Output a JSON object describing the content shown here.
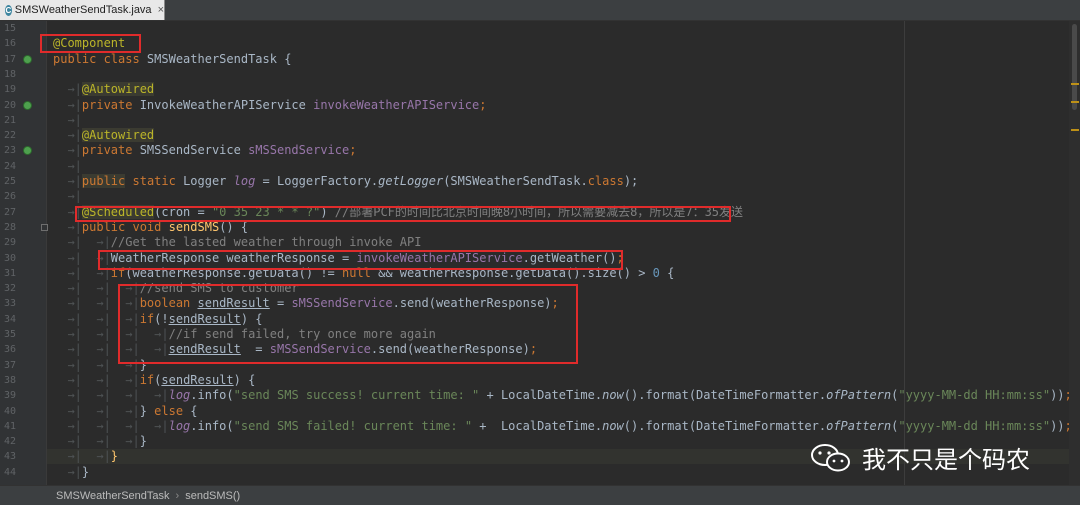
{
  "tab": {
    "label": "SMSWeatherSendTask.java",
    "icon": "java-class-icon"
  },
  "breadcrumb": {
    "class_name": "SMSWeatherSendTask",
    "method_name": "sendSMS()"
  },
  "watermark": {
    "text": "我不只是个码农",
    "icon": "wechat-icon"
  },
  "gutter": [
    {
      "n": "15"
    },
    {
      "n": "16"
    },
    {
      "n": "17",
      "icon": "spring-bean-icon"
    },
    {
      "n": "18"
    },
    {
      "n": "19"
    },
    {
      "n": "20",
      "icon": "spring-bean-icon"
    },
    {
      "n": "21"
    },
    {
      "n": "22"
    },
    {
      "n": "23",
      "icon": "spring-bean-icon"
    },
    {
      "n": "24"
    },
    {
      "n": "25"
    },
    {
      "n": "26"
    },
    {
      "n": "27"
    },
    {
      "n": "28",
      "fold": true
    },
    {
      "n": "29"
    },
    {
      "n": "30"
    },
    {
      "n": "31"
    },
    {
      "n": "32"
    },
    {
      "n": "33"
    },
    {
      "n": "34"
    },
    {
      "n": "35"
    },
    {
      "n": "36"
    },
    {
      "n": "37"
    },
    {
      "n": "38"
    },
    {
      "n": "39"
    },
    {
      "n": "40"
    },
    {
      "n": "41"
    },
    {
      "n": "42"
    },
    {
      "n": "43"
    },
    {
      "n": "44"
    }
  ],
  "code": [
    [],
    [
      [
        "ann",
        "@Component"
      ]
    ],
    [
      [
        "kw",
        "public class "
      ],
      [
        "",
        "SMSWeatherSendTask {"
      ]
    ],
    [],
    [
      [
        "ws",
        "    "
      ],
      [
        "ann annbg",
        "@Autowired"
      ]
    ],
    [
      [
        "ws",
        "    "
      ],
      [
        "kw",
        "private "
      ],
      [
        "",
        "InvokeWeatherAPIService "
      ],
      [
        "fld",
        "invokeWeatherAPIService"
      ],
      [
        "kw",
        ";"
      ]
    ],
    [
      [
        "ws",
        "    "
      ]
    ],
    [
      [
        "ws",
        "    "
      ],
      [
        "ann annbg",
        "@Autowired"
      ]
    ],
    [
      [
        "ws",
        "    "
      ],
      [
        "kw",
        "private "
      ],
      [
        "",
        "SMSSendService "
      ],
      [
        "fld",
        "sMSSendService"
      ],
      [
        "kw",
        ";"
      ]
    ],
    [
      [
        "ws",
        "    "
      ]
    ],
    [
      [
        "ws",
        "    "
      ],
      [
        "kw annbg",
        "public"
      ],
      [
        "kw",
        " static "
      ],
      [
        "",
        "Logger "
      ],
      [
        "fi",
        "log"
      ],
      [
        "",
        " = LoggerFactory."
      ],
      [
        "st",
        "getLogger"
      ],
      [
        "",
        "(SMSWeatherSendTask."
      ],
      [
        "kw",
        "class"
      ],
      [
        "",
        "); "
      ]
    ],
    [
      [
        "ws",
        "    "
      ]
    ],
    [
      [
        "ws",
        "    "
      ],
      [
        "ann annbg",
        "@Scheduled"
      ],
      [
        "",
        "(cron = "
      ],
      [
        "str",
        "\"0 35 23 * * ?\""
      ],
      [
        "",
        ") "
      ],
      [
        "cm",
        "//部署PCF的时间比北京时间晚8小时间，所以需要减去8，所以是7：35发送"
      ]
    ],
    [
      [
        "ws",
        "    "
      ],
      [
        "kw",
        "public void "
      ],
      [
        "fn",
        "sendSMS"
      ],
      [
        "",
        "() {"
      ]
    ],
    [
      [
        "ws",
        "        "
      ],
      [
        "cm",
        "//Get the lasted weather through invoke API"
      ]
    ],
    [
      [
        "ws",
        "        "
      ],
      [
        "",
        "WeatherResponse weatherResponse = "
      ],
      [
        "fld",
        "invokeWeatherAPIService"
      ],
      [
        "",
        ".getWeather()"
      ],
      [
        "kw",
        ";"
      ]
    ],
    [
      [
        "ws",
        "        "
      ],
      [
        "kw",
        "if"
      ],
      [
        "",
        "(weatherResponse.getData() != "
      ],
      [
        "kw",
        "null"
      ],
      [
        "",
        " && weatherResponse.getData().size() > "
      ],
      [
        "num",
        "0"
      ],
      [
        "",
        " {"
      ]
    ],
    [
      [
        "ws",
        "            "
      ],
      [
        "cm",
        "//send SMS to customer"
      ]
    ],
    [
      [
        "ws",
        "            "
      ],
      [
        "kw",
        "boolean "
      ],
      [
        "ul",
        "sendResult"
      ],
      [
        "",
        " = "
      ],
      [
        "fld",
        "sMSSendService"
      ],
      [
        "",
        ".send(weatherResponse)"
      ],
      [
        "kw",
        ";"
      ]
    ],
    [
      [
        "ws",
        "            "
      ],
      [
        "kw",
        "if"
      ],
      [
        "",
        "(!"
      ],
      [
        "ul",
        "sendResult"
      ],
      [
        "",
        ") {"
      ]
    ],
    [
      [
        "ws",
        "                "
      ],
      [
        "cm",
        "//if send failed, try once more again"
      ]
    ],
    [
      [
        "ws",
        "                "
      ],
      [
        "ul",
        "sendResult"
      ],
      [
        "",
        "  = "
      ],
      [
        "fld",
        "sMSSendService"
      ],
      [
        "",
        ".send(weatherResponse)"
      ],
      [
        "kw",
        ";"
      ]
    ],
    [
      [
        "ws",
        "            "
      ],
      [
        "",
        "}"
      ]
    ],
    [
      [
        "ws",
        "            "
      ],
      [
        "kw",
        "if"
      ],
      [
        "",
        "("
      ],
      [
        "ul",
        "sendResult"
      ],
      [
        "",
        ") {"
      ]
    ],
    [
      [
        "ws",
        "                "
      ],
      [
        "fi",
        "log"
      ],
      [
        "",
        ".info("
      ],
      [
        "str",
        "\"send SMS success! current time: \""
      ],
      [
        "",
        " + LocalDateTime."
      ],
      [
        "st",
        "now"
      ],
      [
        "",
        "().format(DateTimeFormatter."
      ],
      [
        "st",
        "ofPattern"
      ],
      [
        "",
        "("
      ],
      [
        "str",
        "\"yyyy-MM-dd HH:mm:ss\""
      ],
      [
        "",
        "))"
      ],
      [
        "kw",
        ";"
      ]
    ],
    [
      [
        "ws",
        "            "
      ],
      [
        "",
        "} "
      ],
      [
        "kw",
        "else "
      ],
      [
        "",
        "{"
      ]
    ],
    [
      [
        "ws",
        "                "
      ],
      [
        "fi",
        "log"
      ],
      [
        "",
        ".info("
      ],
      [
        "str",
        "\"send SMS failed! current time: \""
      ],
      [
        "",
        " +  LocalDateTime."
      ],
      [
        "st",
        "now"
      ],
      [
        "",
        "().format(DateTimeFormatter."
      ],
      [
        "st",
        "ofPattern"
      ],
      [
        "",
        "("
      ],
      [
        "str",
        "\"yyyy-MM-dd HH:mm:ss\""
      ],
      [
        "",
        "))"
      ],
      [
        "kw",
        ";"
      ]
    ],
    [
      [
        "ws",
        "            "
      ],
      [
        "",
        "}"
      ]
    ],
    [
      [
        "ws",
        "        "
      ],
      [
        "fn",
        "}"
      ]
    ],
    [
      [
        "ws",
        "    "
      ],
      [
        "",
        "}"
      ]
    ]
  ]
}
